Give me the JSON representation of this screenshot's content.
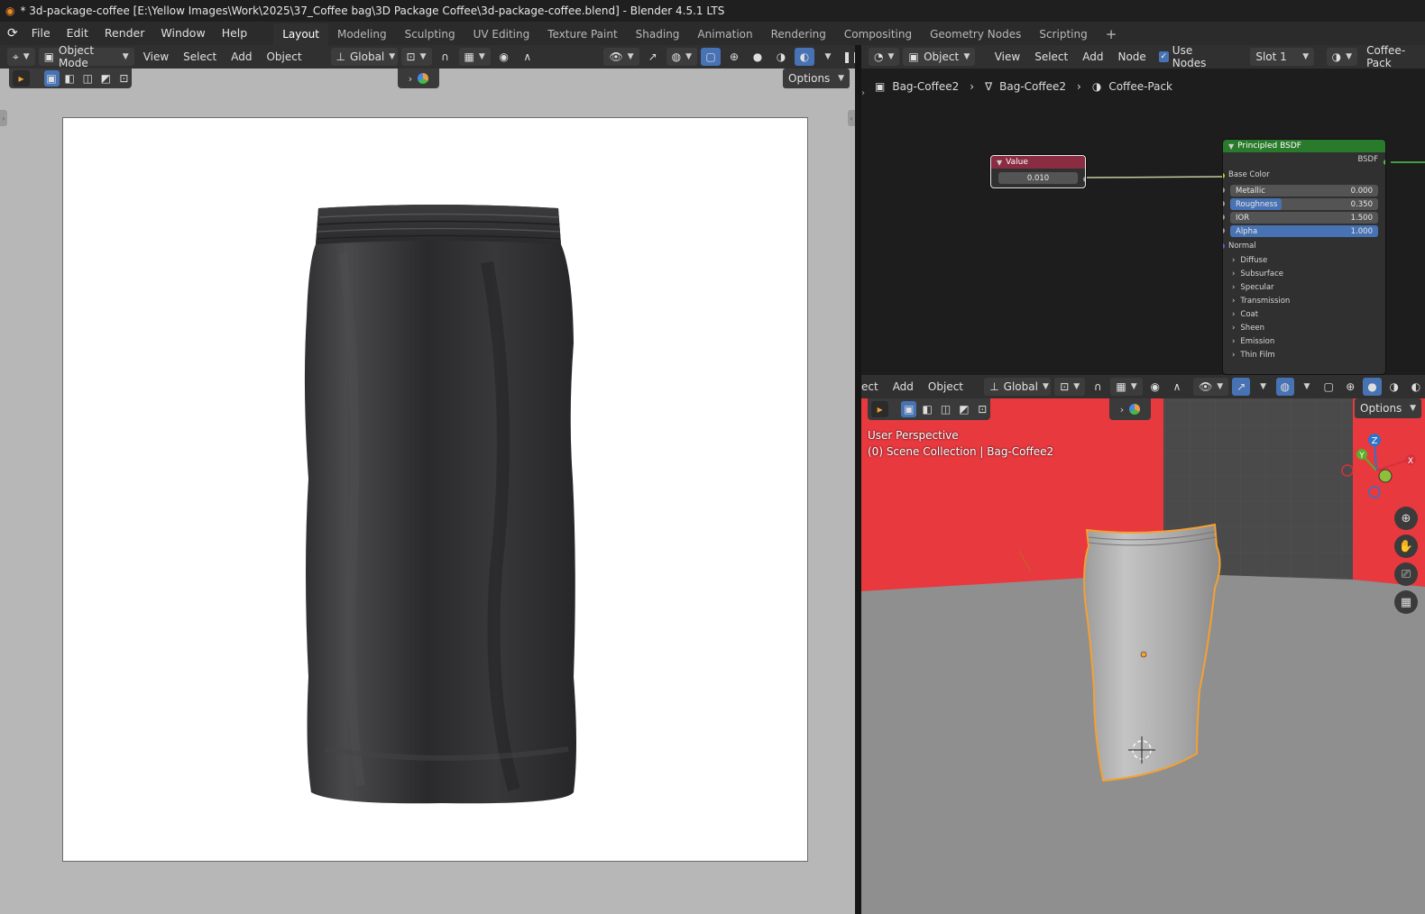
{
  "titlebar": {
    "title": "* 3d-package-coffee [E:\\Yellow Images\\Work\\2025\\37_Coffee bag\\3D Package Coffee\\3d-package-coffee.blend] - Blender 4.5.1 LTS"
  },
  "menu": [
    "File",
    "Edit",
    "Render",
    "Window",
    "Help"
  ],
  "workspaces": [
    "Layout",
    "Modeling",
    "Sculpting",
    "UV Editing",
    "Texture Paint",
    "Shading",
    "Animation",
    "Rendering",
    "Compositing",
    "Geometry Nodes",
    "Scripting"
  ],
  "workspace_add": "+",
  "left_header": {
    "mode": "Object Mode",
    "menus": [
      "View",
      "Select",
      "Add",
      "Object"
    ],
    "orientation": "Global",
    "options": "Options"
  },
  "node_header": {
    "object": "Object",
    "menus": [
      "View",
      "Select",
      "Add",
      "Node"
    ],
    "use_nodes_label": "Use Nodes",
    "use_nodes": true,
    "slot": "Slot 1",
    "material": "Coffee-Pack"
  },
  "breadcrumb": [
    "Bag-Coffee2",
    "Bag-Coffee2",
    "Coffee-Pack"
  ],
  "value_node": {
    "title": "Value",
    "value": "0.010"
  },
  "bsdf_node": {
    "title": "Principled BSDF",
    "output": "BSDF",
    "base_color": "Base Color",
    "props": [
      {
        "label": "Metallic",
        "value": "0.000",
        "fill": 0.0
      },
      {
        "label": "Roughness",
        "value": "0.350",
        "fill": 0.35
      },
      {
        "label": "IOR",
        "value": "1.500",
        "fill": 0.0
      },
      {
        "label": "Alpha",
        "value": "1.000",
        "fill": 1.0
      }
    ],
    "normal": "Normal",
    "panels": [
      "Diffuse",
      "Subsurface",
      "Specular",
      "Transmission",
      "Coat",
      "Sheen",
      "Emission",
      "Thin Film"
    ]
  },
  "viewport": {
    "menus": [
      "ect",
      "Add",
      "Object"
    ],
    "orientation": "Global",
    "options": "Options",
    "overlay_line1": "User Perspective",
    "overlay_line2": "(0) Scene Collection | Bag-Coffee2",
    "gizmo": {
      "z": "Z",
      "y": "Y",
      "x": "X"
    }
  },
  "colors": {
    "accent": "#4772b3",
    "selection": "#f5a032",
    "wall": "#e8393f",
    "value_node": "#8a2c42",
    "bsdf_node": "#2a7a2c"
  }
}
